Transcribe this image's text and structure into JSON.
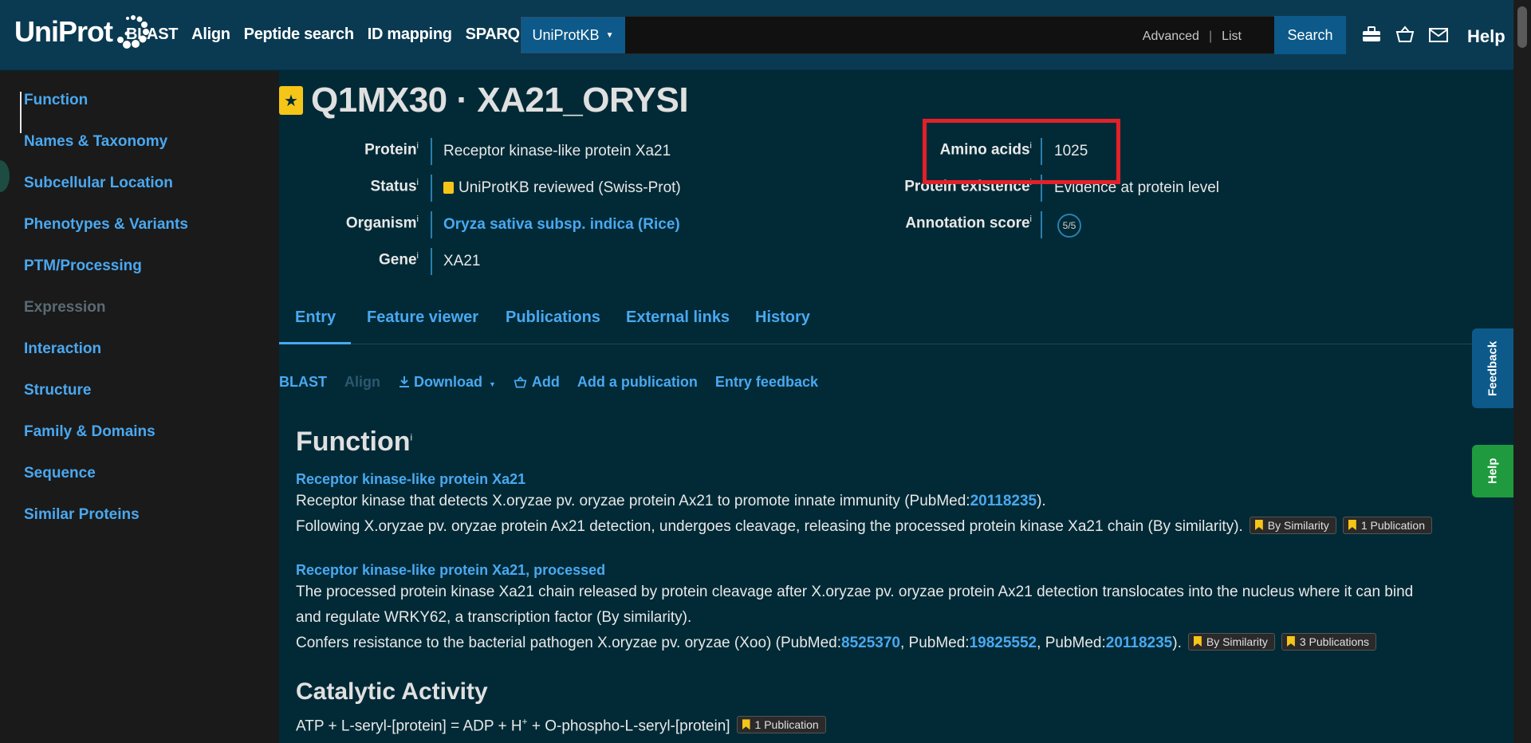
{
  "header": {
    "logo": "UniProt",
    "nav": [
      "BLAST",
      "Align",
      "Peptide search",
      "ID mapping",
      "SPARQL"
    ],
    "db_select": "UniProtKB",
    "advanced": "Advanced",
    "list": "List",
    "search": "Search",
    "help": "Help"
  },
  "sidebar": {
    "items": [
      {
        "label": "Function"
      },
      {
        "label": "Names & Taxonomy"
      },
      {
        "label": "Subcellular Location"
      },
      {
        "label": "Phenotypes & Variants"
      },
      {
        "label": "PTM/Processing"
      },
      {
        "label": "Expression"
      },
      {
        "label": "Interaction"
      },
      {
        "label": "Structure"
      },
      {
        "label": "Family & Domains"
      },
      {
        "label": "Sequence"
      },
      {
        "label": "Similar Proteins"
      }
    ]
  },
  "entry": {
    "title": "Q1MX30 · XA21_ORYSI",
    "protein_label": "Protein",
    "protein": "Receptor kinase-like protein Xa21",
    "status_label": "Status",
    "status": "UniProtKB reviewed (Swiss-Prot)",
    "organism_label": "Organism",
    "organism": "Oryza sativa subsp. indica (Rice)",
    "gene_label": "Gene",
    "gene": "XA21",
    "amino_label": "Amino acids",
    "amino": "1025",
    "existence_label": "Protein existence",
    "existence": "Evidence at protein level",
    "score_label": "Annotation score",
    "score": "5/5",
    "info_marker": "i"
  },
  "tabs": [
    "Entry",
    "Feature viewer",
    "Publications",
    "External links",
    "History"
  ],
  "toolbar": {
    "blast": "BLAST",
    "align": "Align",
    "download": "Download",
    "add": "Add",
    "add_pub": "Add a publication",
    "feedback": "Entry feedback"
  },
  "function": {
    "title": "Function",
    "sub1": "Receptor kinase-like protein Xa21",
    "p1_text": "Receptor kinase that detects X.oryzae pv. oryzae protein Ax21 to promote innate immunity (PubMed:",
    "p1_pm": "20118235",
    "p1_end": ").",
    "p2_text": "Following X.oryzae pv. oryzae protein Ax21 detection, undergoes cleavage, releasing the processed protein kinase Xa21 chain (By similarity).",
    "ev_sim": "By Similarity",
    "ev_1pub": "1 Publication",
    "sub2": "Receptor kinase-like protein Xa21, processed",
    "p3_line1": "The processed protein kinase Xa21 chain released by protein cleavage after X.oryzae pv. oryzae protein Ax21 detection translocates into the nucleus where it can bind",
    "p3_line2": "and regulate WRKY62, a transcription factor (By similarity).",
    "p4_a": "Confers resistance to the bacterial pathogen X.oryzae pv. oryzae (Xoo) (PubMed:",
    "p4_pm1": "8525370",
    "p4_b": ", PubMed:",
    "p4_pm2": "19825552",
    "p4_c": ", PubMed:",
    "p4_pm3": "20118235",
    "p4_d": ").",
    "ev_3pub": "3 Publications"
  },
  "catalytic": {
    "title": "Catalytic Activity",
    "reaction_a": "ATP + L-seryl-[protein] = ADP + H",
    "reaction_sup": "+",
    "reaction_b": " + O-phospho-L-seryl-[protein]",
    "ev": "1 Publication"
  },
  "side_tabs": {
    "feedback": "Feedback",
    "help": "Help"
  },
  "colors": {
    "highlight": "#e3202a",
    "link": "#4aa8f0",
    "feedback_tab": "#0d5a8a",
    "help_tab": "#1f9a3e"
  }
}
